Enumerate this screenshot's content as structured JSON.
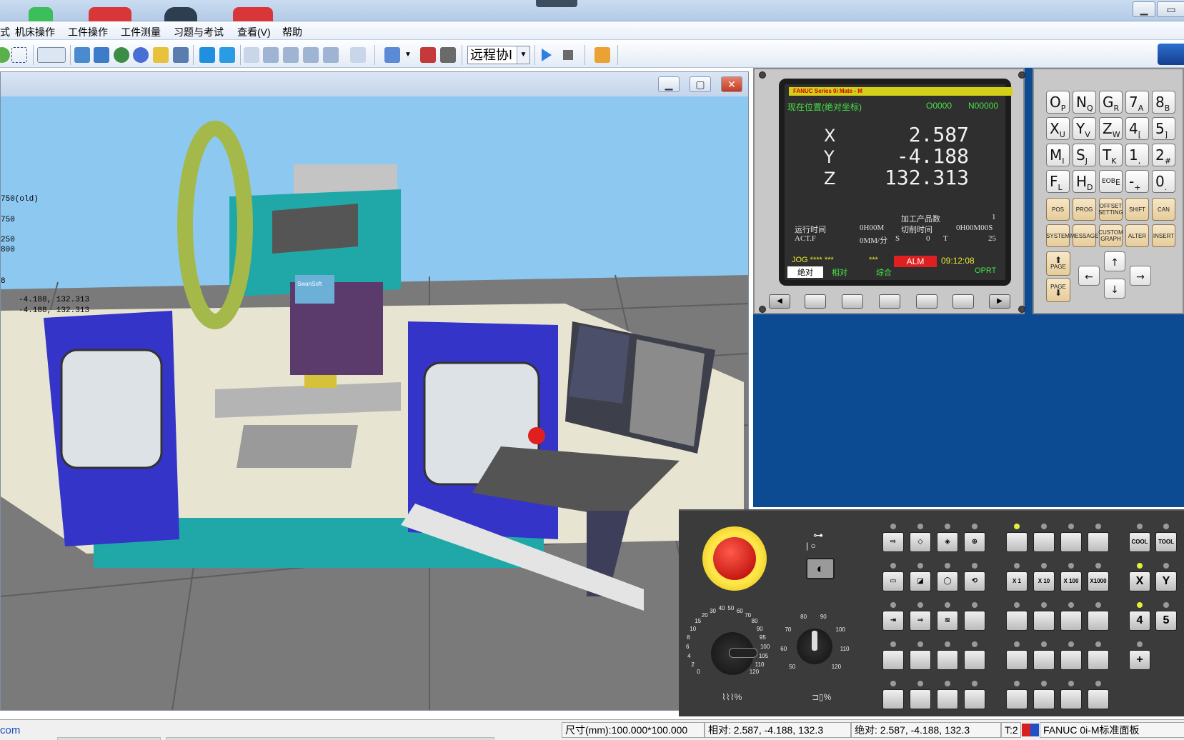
{
  "menu": {
    "items": [
      "式",
      "机床操作",
      "工件操作",
      "工件测量",
      "习题与考试",
      "查看(V)",
      "帮助"
    ]
  },
  "toolbar": {
    "mode_combo": "远程协I"
  },
  "viewport": {
    "coords": [
      "750(old)",
      "750",
      "250",
      "800",
      "8",
      "-4.188,  132.313",
      "-4.188,  132.313"
    ],
    "spindle_label": "SwanSoft"
  },
  "cnc_screen": {
    "brand": "FANUC Series 0i Mate - M",
    "title": "现在位置(绝对坐标)",
    "program": "O0000",
    "sequence": "N00000",
    "axes": [
      {
        "label": "X",
        "value": "2.587"
      },
      {
        "label": "Y",
        "value": "-4.188"
      },
      {
        "label": "Z",
        "value": "132.313"
      }
    ],
    "parts_label": "加工产品数",
    "parts_value": "1",
    "run_time_label": "运行时间",
    "run_time_value": "0H00M",
    "cut_time_label": "切削时间",
    "cut_time_value": "0H00M00S",
    "actf_label": "ACT.F",
    "actf_value": "0MM/分",
    "s_label": "S",
    "s_value": "0",
    "t_label": "T",
    "t_value": "25",
    "mode": "JOG **** ***",
    "mode_stars": "***",
    "alarm": "ALM",
    "clock": "09:12:08",
    "softkeys": [
      "绝对",
      "相对",
      "综合",
      "",
      "OPRT"
    ]
  },
  "keypad": {
    "rows": [
      [
        [
          "O",
          "P"
        ],
        [
          "N",
          "Q"
        ],
        [
          "G",
          "R"
        ],
        [
          "7",
          "A"
        ],
        [
          "8",
          "B"
        ]
      ],
      [
        [
          "X",
          "U"
        ],
        [
          "Y",
          "V"
        ],
        [
          "Z",
          "W"
        ],
        [
          "4",
          "["
        ],
        [
          "5",
          "]"
        ]
      ],
      [
        [
          "M",
          "I"
        ],
        [
          "S",
          "J"
        ],
        [
          "T",
          "K"
        ],
        [
          "1",
          ","
        ],
        [
          "2",
          "#"
        ]
      ],
      [
        [
          "F",
          "L"
        ],
        [
          "H",
          "D"
        ],
        [
          "EOB",
          "E"
        ],
        [
          "-",
          "+"
        ],
        [
          "0",
          "."
        ]
      ]
    ],
    "func_row1": [
      "POS",
      "PROG",
      "OFFSET SETTING",
      "SHIFT",
      "CAN"
    ],
    "func_row2": [
      "SYSTEM",
      "MESSAGE",
      "CUSTOM GRAPH",
      "ALTER",
      "INSERT"
    ],
    "page_up": "PAGE",
    "page_down": "PAGE"
  },
  "operator_panel": {
    "mult_buttons": [
      "X 1",
      "X 10",
      "X 100",
      "X1000"
    ],
    "right_buttons": [
      "COOL",
      "TOOL",
      "X",
      "Y",
      "4",
      "5",
      "+"
    ],
    "feed_scale": [
      "0",
      "2",
      "4",
      "6",
      "8",
      "10",
      "15",
      "20",
      "30",
      "40",
      "50",
      "60",
      "70",
      "80",
      "90",
      "95",
      "100",
      "105",
      "110",
      "120"
    ],
    "spindle_scale": [
      "50",
      "60",
      "70",
      "80",
      "90",
      "100",
      "110",
      "120"
    ],
    "percent": "%"
  },
  "status": {
    "link": "com",
    "size": "尺寸(mm):100.000*100.000",
    "relative": "相对:   2.587,  -4.188,  132.3",
    "absolute": "绝对:   2.587,  -4.188,  132.3",
    "tool": "T:2",
    "panel": "FANUC 0i-M标准面板"
  },
  "colors": {
    "sky": "#8cc8f0",
    "floor": "#7a7a7a",
    "machine_blue": "#3434c8",
    "teal": "#20a8a8",
    "cnc_blue": "#0c4a92"
  }
}
